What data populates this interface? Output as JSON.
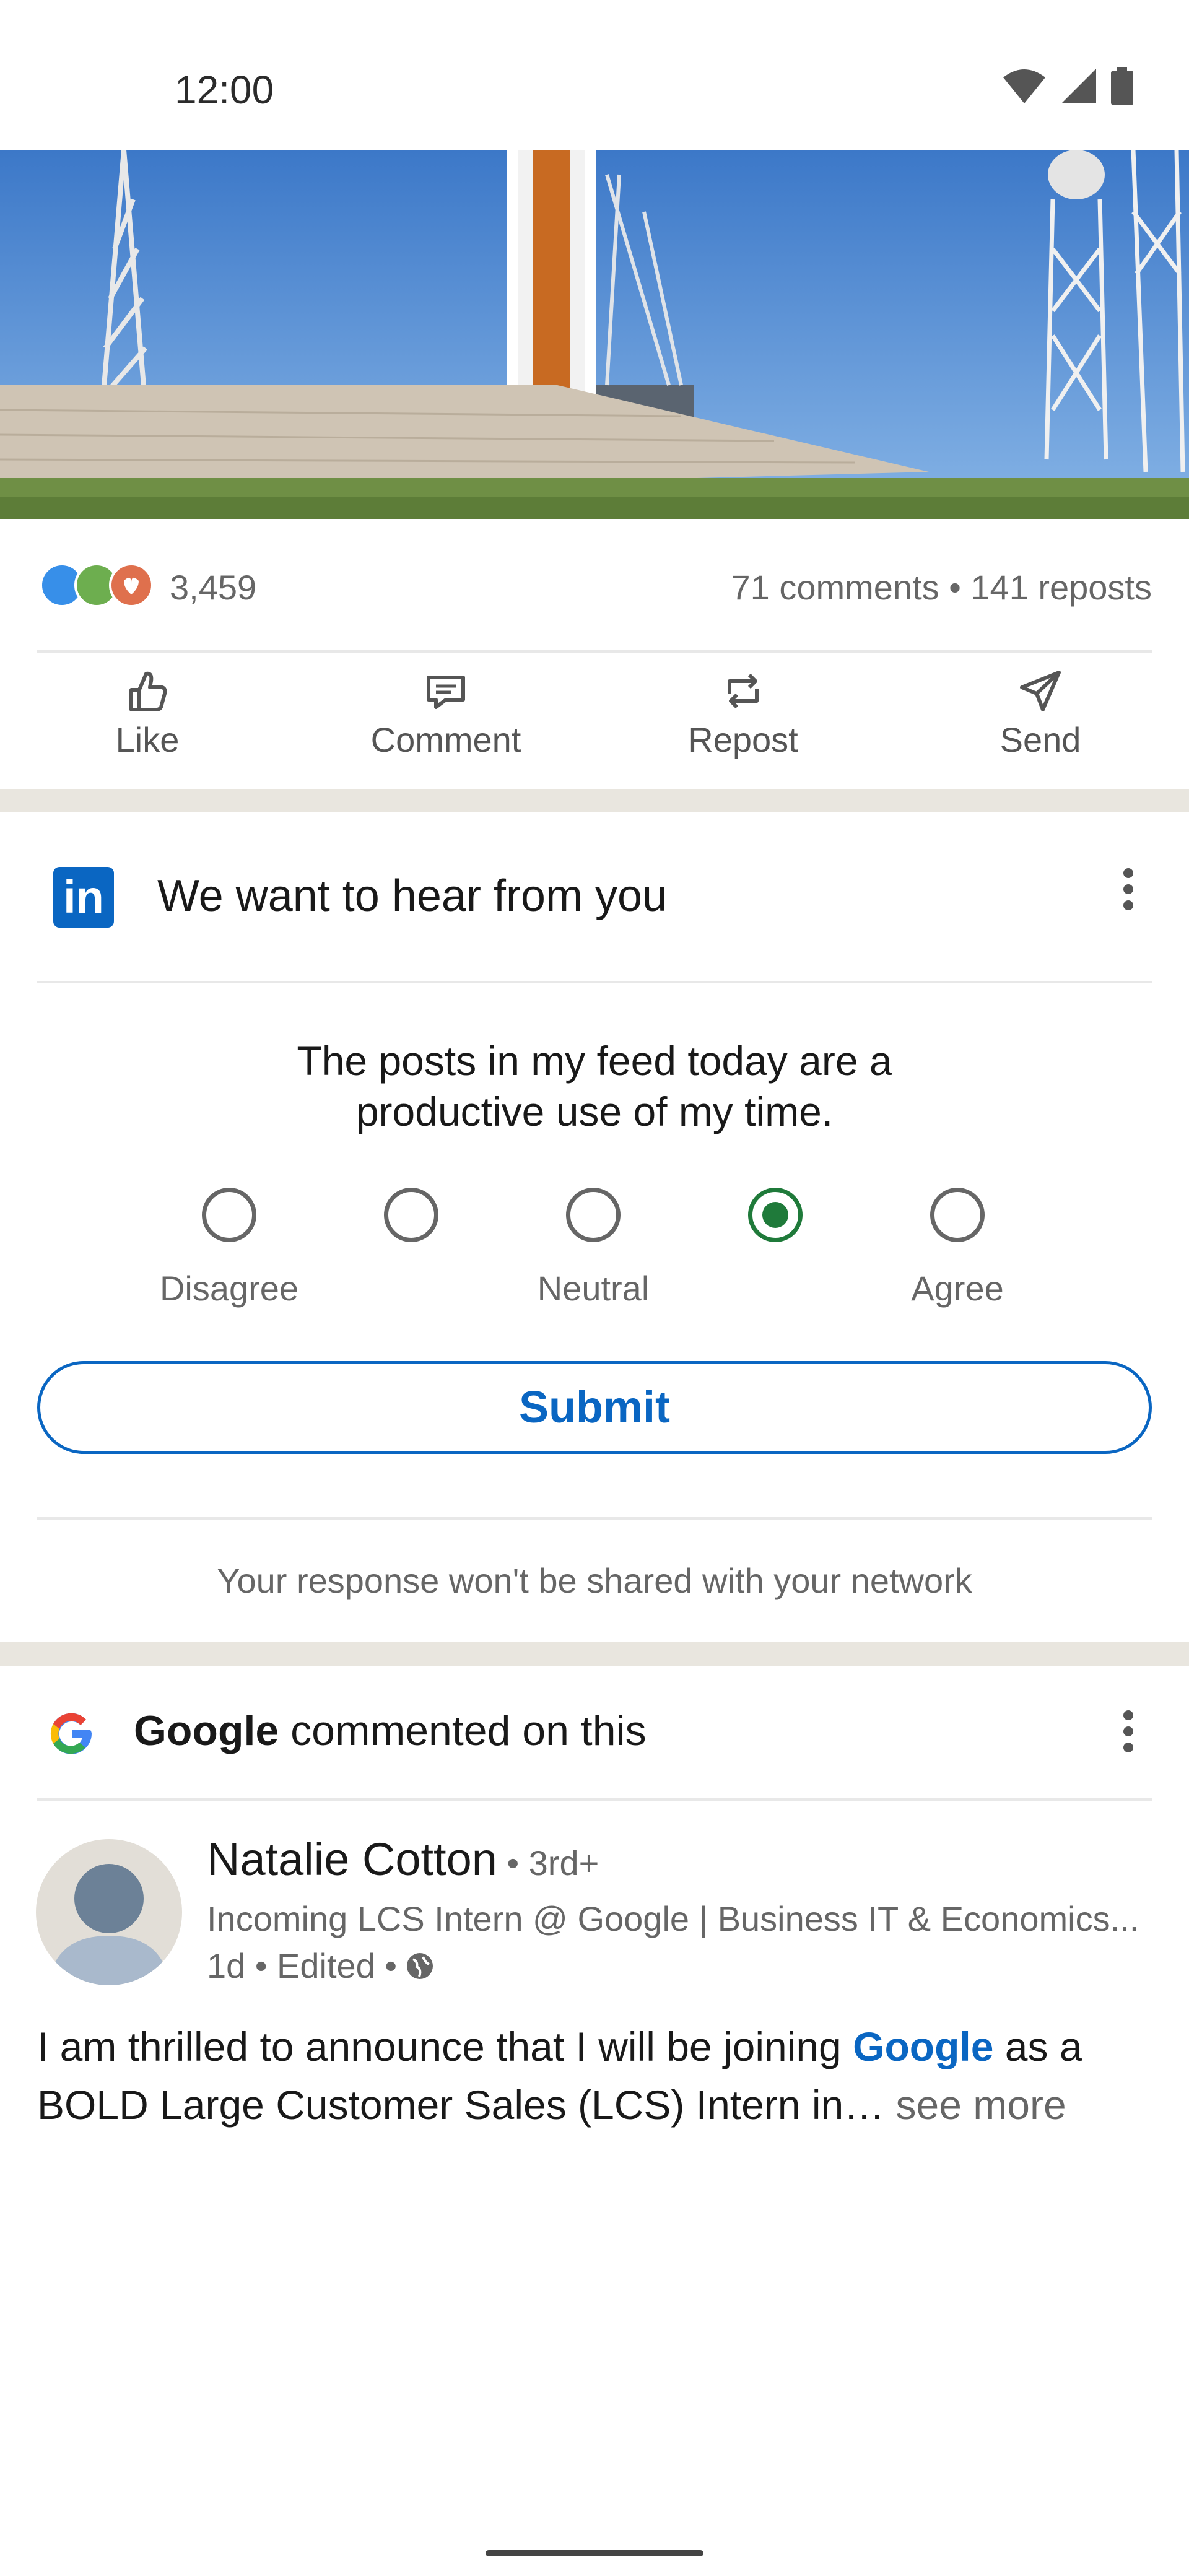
{
  "status_bar": {
    "time": "12:00"
  },
  "post_stats": {
    "reactions_count": "3,459",
    "engagement": "71 comments • 141 reposts"
  },
  "actions": [
    {
      "label": "Like",
      "icon": "like-icon"
    },
    {
      "label": "Comment",
      "icon": "comment-icon"
    },
    {
      "label": "Repost",
      "icon": "repost-icon"
    },
    {
      "label": "Send",
      "icon": "send-icon"
    }
  ],
  "survey": {
    "logo_text": "in",
    "title": "We want to hear from you",
    "question_line1": "The posts in my feed today are a",
    "question_line2": "productive use of my time.",
    "scale_labels": {
      "left": "Disagree",
      "middle": "Neutral",
      "right": "Agree"
    },
    "selected_option": 4,
    "submit_label": "Submit",
    "privacy_note": "Your response won't be shared with your network"
  },
  "activity": {
    "company": "Google",
    "action_text": " commented on this"
  },
  "post": {
    "author": "Natalie Cotton",
    "degree": " • 3rd+",
    "headline": "Incoming LCS Intern @ Google | Business IT & Economics...",
    "meta": "1d • Edited •",
    "text_before": "I am thrilled to announce that I will be joining ",
    "mention": "Google",
    "text_after": " as a BOLD Large Customer Sales (LCS) Intern in…",
    "see_more": " see more"
  },
  "colors": {
    "linkedin_blue": "#0a66c2",
    "selected_green": "#1f7a3a",
    "separator": "#e9e6df"
  }
}
